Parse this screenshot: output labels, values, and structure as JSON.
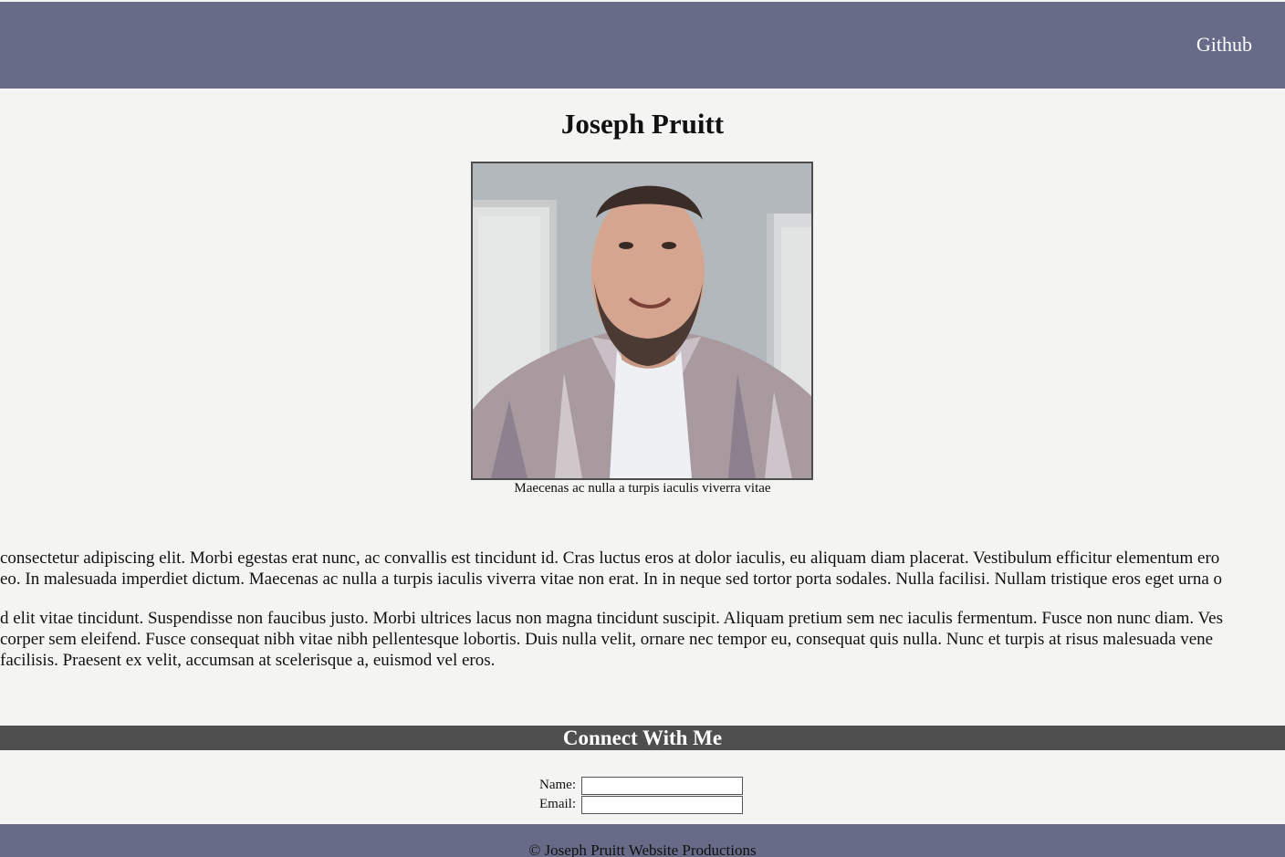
{
  "header": {
    "nav_link": "Github",
    "background_color": "#686b88"
  },
  "main": {
    "title": "Joseph Pruitt",
    "image_caption": "Maecenas ac nulla a turpis iaculis viverra vitae",
    "paragraphs": [
      {
        "lines": [
          "consectetur adipiscing elit. Morbi egestas erat nunc, ac convallis est tincidunt id. Cras luctus eros at dolor iaculis, eu aliquam diam placerat. Vestibulum efficitur elementum ero",
          "eo. In malesuada imperdiet dictum. Maecenas ac nulla a turpis iaculis viverra vitae non erat. In in neque sed tortor porta sodales. Nulla facilisi. Nullam tristique eros eget urna o"
        ]
      },
      {
        "lines": [
          "d elit vitae tincidunt. Suspendisse non faucibus justo. Morbi ultrices lacus non magna tincidunt suscipit. Aliquam pretium sem nec iaculis fermentum. Fusce non nunc diam. Ves",
          "corper sem eleifend. Fusce consequat nibh vitae nibh pellentesque lobortis. Duis nulla velit, ornare nec tempor eu, consequat quis nulla. Nunc et turpis at risus malesuada vene",
          "facilisis. Praesent ex velit, accumsan at scelerisque a, euismod vel eros."
        ]
      }
    ]
  },
  "connect": {
    "title": "Connect With Me",
    "name_label": "Name:",
    "name_value": "",
    "email_label": "Email:",
    "email_value": "",
    "bar_color": "#4f4f4f"
  },
  "footer": {
    "text": "© Joseph Pruitt Website Productions"
  }
}
